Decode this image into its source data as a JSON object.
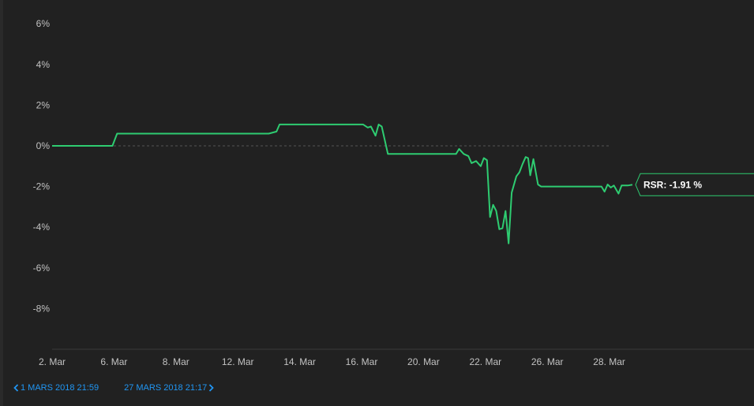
{
  "chart_data": {
    "type": "line",
    "yticks": [
      "6%",
      "4%",
      "2%",
      "0%",
      "-2%",
      "-4%",
      "-6%",
      "-8%"
    ],
    "yvalues": [
      6,
      4,
      2,
      0,
      -2,
      -4,
      -6,
      -8
    ],
    "ylim": [
      -10,
      6
    ],
    "xticks": [
      "2. Mar",
      "6. Mar",
      "8. Mar",
      "12. Mar",
      "14. Mar",
      "16. Mar",
      "20. Mar",
      "22. Mar",
      "26. Mar",
      "28. Mar"
    ],
    "grid": false,
    "series": [
      {
        "color": "#2ecc71",
        "points": [
          [
            0,
            0
          ],
          [
            1,
            0
          ],
          [
            1.95,
            0
          ],
          [
            2.1,
            0.6
          ],
          [
            3,
            0.6
          ],
          [
            4,
            0.6
          ],
          [
            5,
            0.6
          ],
          [
            6,
            0.6
          ],
          [
            7.0,
            0.6
          ],
          [
            7.25,
            0.7
          ],
          [
            7.35,
            1.05
          ],
          [
            8,
            1.05
          ],
          [
            9,
            1.05
          ],
          [
            10.05,
            1.05
          ],
          [
            10.2,
            0.9
          ],
          [
            10.3,
            0.95
          ],
          [
            10.45,
            0.5
          ],
          [
            10.55,
            1.05
          ],
          [
            10.65,
            0.95
          ],
          [
            10.85,
            -0.4
          ],
          [
            11,
            -0.4
          ],
          [
            12,
            -0.4
          ],
          [
            13.05,
            -0.4
          ],
          [
            13.15,
            -0.15
          ],
          [
            13.3,
            -0.4
          ],
          [
            13.45,
            -0.5
          ],
          [
            13.55,
            -0.85
          ],
          [
            13.7,
            -0.75
          ],
          [
            13.85,
            -1.0
          ],
          [
            13.95,
            -0.6
          ],
          [
            14.05,
            -0.7
          ],
          [
            14.15,
            -3.5
          ],
          [
            14.25,
            -2.9
          ],
          [
            14.35,
            -3.2
          ],
          [
            14.45,
            -4.1
          ],
          [
            14.55,
            -4.05
          ],
          [
            14.65,
            -3.2
          ],
          [
            14.75,
            -4.8
          ],
          [
            14.85,
            -2.3
          ],
          [
            15.0,
            -1.5
          ],
          [
            15.1,
            -1.3
          ],
          [
            15.2,
            -0.9
          ],
          [
            15.3,
            -0.55
          ],
          [
            15.38,
            -0.6
          ],
          [
            15.45,
            -1.45
          ],
          [
            15.55,
            -0.65
          ],
          [
            15.7,
            -1.9
          ],
          [
            15.8,
            -2.0
          ],
          [
            16,
            -2.0
          ],
          [
            16.5,
            -2.0
          ],
          [
            17,
            -2.0
          ],
          [
            17.5,
            -2.0
          ],
          [
            17.75,
            -2.0
          ],
          [
            17.85,
            -2.25
          ],
          [
            17.95,
            -1.9
          ],
          [
            18.05,
            -2.05
          ],
          [
            18.15,
            -1.95
          ],
          [
            18.3,
            -2.35
          ],
          [
            18.4,
            -1.95
          ],
          [
            18.6,
            -1.95
          ],
          [
            18.75,
            -1.91
          ]
        ]
      }
    ],
    "label": {
      "text": "RSR: -1.91 %"
    }
  },
  "range": {
    "start_label": "1 MARS 2018 21:59",
    "end_label": "27 MARS 2018 21:17"
  }
}
